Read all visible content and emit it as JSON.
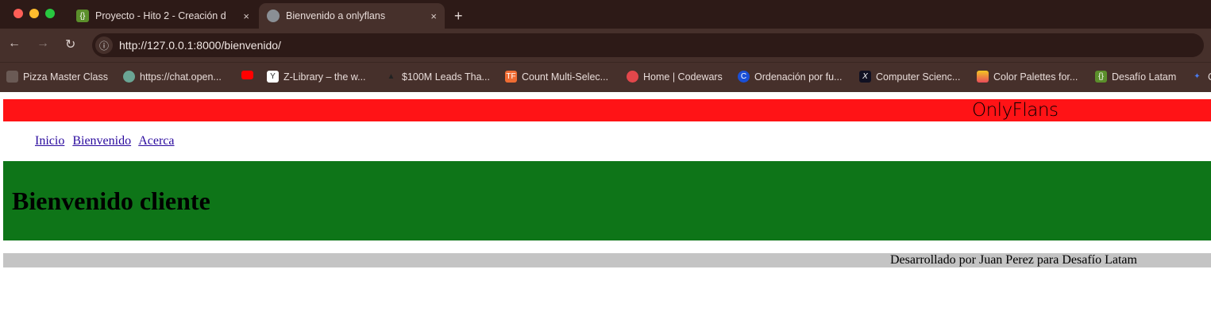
{
  "browser": {
    "tabs": [
      {
        "title": "Proyecto - Hito 2 - Creación d",
        "icon": "code-icon"
      },
      {
        "title": "Bienvenido a onlyflans",
        "icon": "globe-icon"
      }
    ],
    "new_tab": "+",
    "close": "×",
    "url": "http://127.0.0.1:8000/bienvenido/",
    "bookmarks": [
      "Pizza Master Class",
      "https://chat.open...",
      "",
      "Z-Library – the w...",
      "$100M Leads Tha...",
      "Count Multi-Selec...",
      "Home | Codewars",
      "Ordenación por fu...",
      "Computer Scienc...",
      "Color Palettes for...",
      "Desafío Latam",
      "C"
    ]
  },
  "page": {
    "brand": "OnlyFlans",
    "nav": [
      "Inicio",
      "Bienvenido",
      "Acerca"
    ],
    "heading": "Bienvenido cliente",
    "footer": "Desarrollado por Juan Perez para Desafío Latam"
  },
  "colors": {
    "banner": "#ff1316",
    "hero": "#0e7518",
    "footer": "#c4c4c4"
  }
}
